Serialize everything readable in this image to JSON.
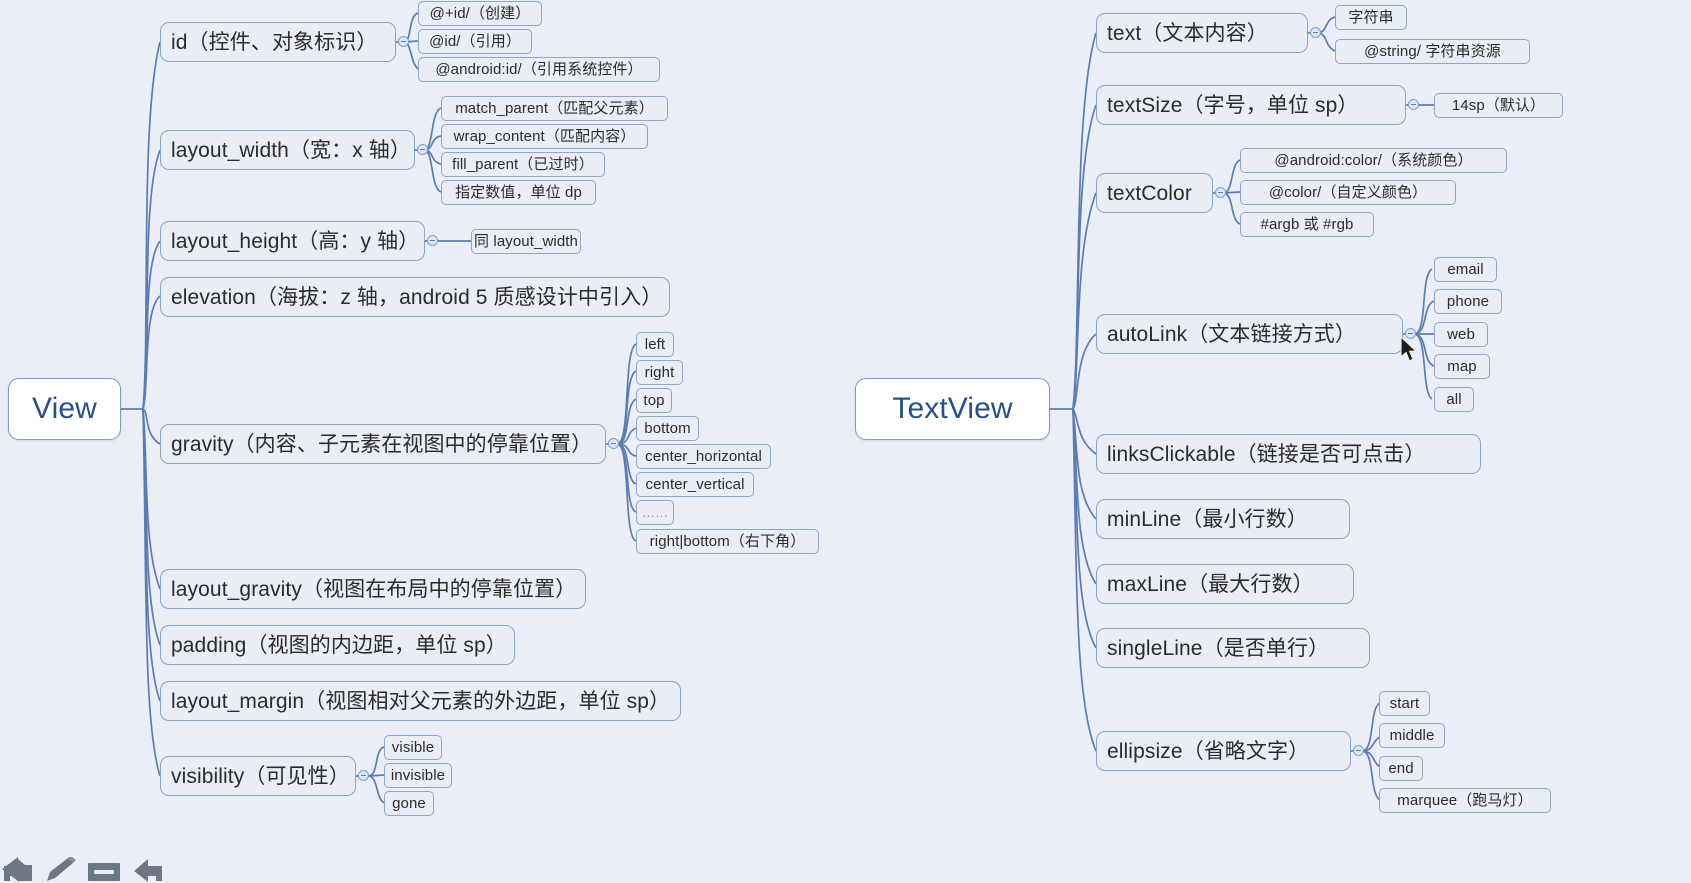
{
  "canvas": {
    "background": "#eceef7",
    "node_border": "#8fa7c8",
    "node_fill": "#ebedf6",
    "root_fill": "#ffffff",
    "root_text": "#2a4f84",
    "link_color": "#5b7cb0"
  },
  "roots": {
    "view": "View",
    "textview": "TextView"
  },
  "view_branch": [
    {
      "label": "id（控件、对象标识）",
      "children": [
        "@+id/（创建）",
        "@id/（引用）",
        "@android:id/（引用系统控件）"
      ]
    },
    {
      "label": "layout_width（宽：x 轴）",
      "children": [
        "match_parent（匹配父元素）",
        "wrap_content（匹配内容）",
        "fill_parent（已过时）",
        "指定数值，单位 dp"
      ]
    },
    {
      "label": "layout_height（高：y 轴）",
      "children": [
        "同 layout_width"
      ]
    },
    {
      "label": "elevation（海拔：z 轴，android 5 质感设计中引入）",
      "children": []
    },
    {
      "label": "gravity（内容、子元素在视图中的停靠位置）",
      "children": [
        "left",
        "right",
        "top",
        "bottom",
        "center_horizontal",
        "center_vertical",
        "……",
        "right|bottom（右下角）"
      ]
    },
    {
      "label": "layout_gravity（视图在布局中的停靠位置）",
      "children": []
    },
    {
      "label": "padding（视图的内边距，单位 sp）",
      "children": []
    },
    {
      "label": "layout_margin（视图相对父元素的外边距，单位 sp）",
      "children": []
    },
    {
      "label": "visibility（可见性）",
      "children": [
        "visible",
        "invisible",
        "gone"
      ]
    }
  ],
  "textview_branch": [
    {
      "label": "text（文本内容）",
      "children": [
        "字符串",
        "@string/ 字符串资源"
      ]
    },
    {
      "label": "textSize（字号，单位 sp）",
      "children": [
        "14sp（默认）"
      ]
    },
    {
      "label": "textColor",
      "children": [
        "@android:color/（系统颜色）",
        "@color/（自定义颜色）",
        "#argb 或 #rgb"
      ]
    },
    {
      "label": "autoLink（文本链接方式）",
      "children": [
        "email",
        "phone",
        "web",
        "map",
        "all"
      ]
    },
    {
      "label": "linksClickable（链接是否可点击）",
      "children": []
    },
    {
      "label": "minLine（最小行数）",
      "children": []
    },
    {
      "label": "maxLine（最大行数）",
      "children": []
    },
    {
      "label": "singleLine（是否单行）",
      "children": []
    },
    {
      "label": "ellipsize（省略文字）",
      "children": [
        "start",
        "middle",
        "end",
        "marquee（跑马灯）"
      ]
    }
  ],
  "toolbar": [
    {
      "icon": "undo-arrow-icon"
    },
    {
      "icon": "pencil-edit-icon"
    },
    {
      "icon": "node-rectangle-icon"
    },
    {
      "icon": "redo-arrow-icon"
    }
  ]
}
